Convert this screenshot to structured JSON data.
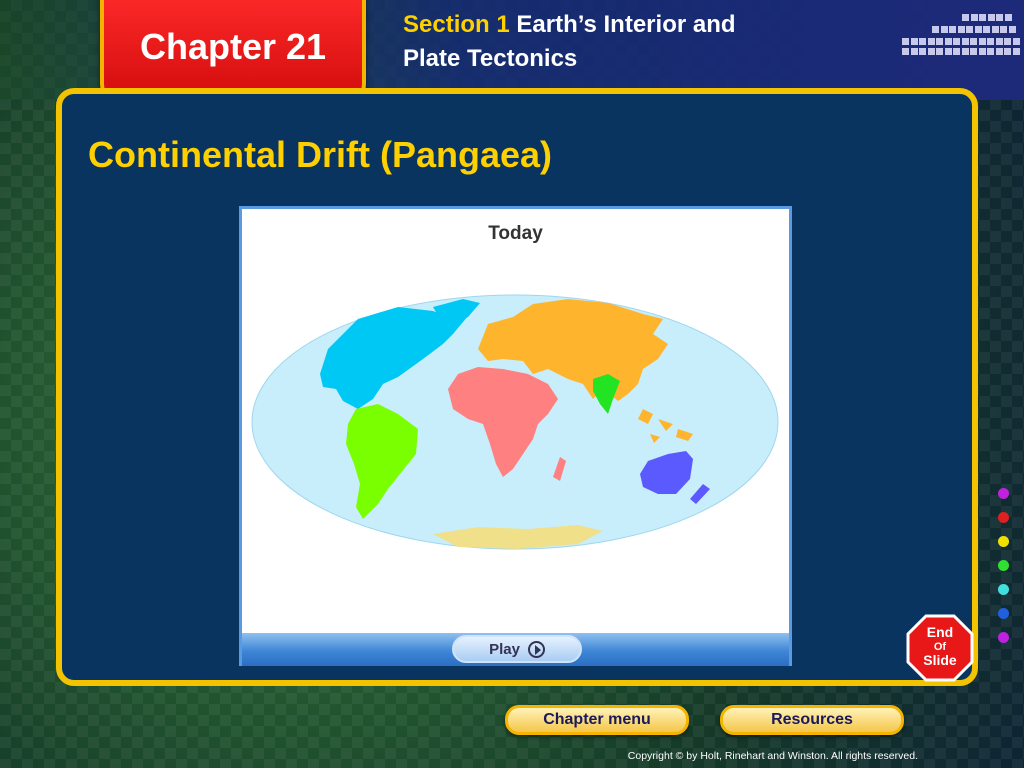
{
  "header": {
    "chapter_label": "Chapter 21",
    "section_prefix": "Section 1",
    "section_title_line1": "Earth’s Interior and",
    "section_title_line2": "Plate Tectonics"
  },
  "slide": {
    "title": "Continental Drift (Pangaea)"
  },
  "animation": {
    "frame_label": "Today",
    "play_label": "Play"
  },
  "stop_sign": {
    "line1": "End",
    "line2": "Of",
    "line3": "Slide"
  },
  "nav": {
    "chapter_menu": "Chapter menu",
    "resources": "Resources"
  },
  "footer": {
    "copyright": "Copyright © by Holt, Rinehart and Winston. All rights reserved."
  },
  "colors": {
    "panel_bg": "#08345f",
    "accent_yellow": "#ffd000",
    "chapter_red": "#e01010",
    "north_america": "#00c8f5",
    "south_america": "#7aff00",
    "eurasia": "#ffb42e",
    "africa": "#ff8080",
    "india": "#22e422",
    "australia": "#5a5aff",
    "antarctica": "#f0e08a",
    "ocean": "#c8eefb"
  },
  "side_dots": [
    "#c020e0",
    "#e02020",
    "#f0e000",
    "#30e030",
    "#40e0e0",
    "#2060e0",
    "#c020e0"
  ]
}
